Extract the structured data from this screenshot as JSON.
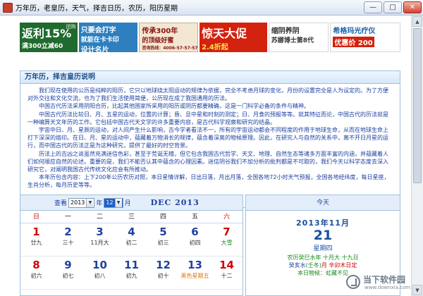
{
  "window": {
    "title": "万年历，老皇历，天气，择吉日历，农历，阳历星期",
    "min_glyph": "—",
    "max_glyph": "□",
    "close_glyph": "✕"
  },
  "ads": [
    {
      "line1": "",
      "big": "返利15%",
      "line2": "满300立减60",
      "tag": "团购"
    },
    {
      "line1": "只要会打字",
      "big": "",
      "line2": "就能在卡卡印",
      "line3": "设计名片"
    },
    {
      "line1": "传承300年",
      "big": "",
      "line2": "的顶级好蜜",
      "line3": "咨询热线：4006-57-57-57"
    },
    {
      "line1": "",
      "big": "惊天大促",
      "line2": "2.4折起"
    },
    {
      "line1": "缩阴养阴",
      "big": "",
      "line2": "苏娜博士第8代"
    },
    {
      "line1": "希格玛光疗仪",
      "big": "",
      "line2": "200",
      "tag": "优惠价"
    }
  ],
  "panel": {
    "title": "万年历，择吉皇历说明",
    "paragraphs": [
      "我们现在使用的公历是纯粹的阳历，它只以地球绕太阳运动的规律为依据，完全不考虑月球的变化，月份的设置完全是人为设定的。为了方便对外交往和文化交流，也为了我们生活使用简便，公历现在成了我国通用的历法。",
      "中国古代历法采用阴阳合历，比起其他国家所采用的阳历或阴历都要精确，这是一门科学必备的条件与精神。",
      "中国古代历法比较日、月、五星的运动，位置的计算；昏、旦中星和时刻的测定；日、月食的预报等等。就其特征而论，中国古代的历法就是一种编算天文年历的工作。它包括中国古代天文学的许多重要内容，是古代科学观察和研究的结晶。",
      "宇宙中日、月、星辰的运动，对人间产生什么影响，古今学者看法不一，所有的宇宙运动都会不同程度的作用于地球生命，从而在地球生命上打下深深的烙印。在日、月、星的运动中，蕴藏着万物消长的规律，蕴含着深奥的物候原理。因此，在研究人与自然的关系中，离不开日月星的运行，而中国古代的历法正是为这种研究，提供了最好的时空背景。",
      "历法上的吉凶之说虽然充满迷信色彩，甚至于荒诞无稽，但它包含我国古代哲学、天文、地理、自然生态等诸多方面丰富的内涵，并蕴藏着人们如何顺应自然的论述。重要的是，我们不能否认其中蕴含的心理因素。迷信阴谷我们不加分析的批判都是不可取的，我们今天以科学态度去深入研究它，对阐明我国古代传统文化应会有所推动。",
      "本年历包含内容：上下200年公历农历对照，本日星情详解，日出日落，月出月落，全国各地72小时天气预报，全国各地经纬度，每日星座，生肖分析，每月历史等等。"
    ]
  },
  "calendar": {
    "view_label": "查看",
    "year_value": "2013",
    "year_unit": "年",
    "month_value": "12",
    "month_unit": "月",
    "month_title": "DEC 2013",
    "weekdays": [
      "日",
      "一",
      "二",
      "三",
      "四",
      "五",
      "六"
    ],
    "weeks": [
      [
        {
          "n": "1",
          "l": "廿九",
          "nc": "red",
          "lc": ""
        },
        {
          "n": "2",
          "l": "三十",
          "nc": "",
          "lc": ""
        },
        {
          "n": "3",
          "l": "11月大",
          "nc": "",
          "lc": ""
        },
        {
          "n": "4",
          "l": "初二",
          "nc": "",
          "lc": ""
        },
        {
          "n": "5",
          "l": "初三",
          "nc": "",
          "lc": ""
        },
        {
          "n": "6",
          "l": "初四",
          "nc": "",
          "lc": ""
        },
        {
          "n": "7",
          "l": "大雪",
          "nc": "red",
          "lc": "green"
        }
      ],
      [
        {
          "n": "8",
          "l": "初六",
          "nc": "red",
          "lc": ""
        },
        {
          "n": "9",
          "l": "初七",
          "nc": "",
          "lc": ""
        },
        {
          "n": "10",
          "l": "初八",
          "nc": "",
          "lc": ""
        },
        {
          "n": "11",
          "l": "初九",
          "nc": "",
          "lc": ""
        },
        {
          "n": "12",
          "l": "初十",
          "nc": "",
          "lc": ""
        },
        {
          "n": "13",
          "l": "黑色星期五",
          "nc": "",
          "lc": "orange"
        },
        {
          "n": "14",
          "l": "十二",
          "nc": "red",
          "lc": ""
        }
      ]
    ]
  },
  "today": {
    "header": "今天",
    "year_month": "2013年11月",
    "day": "21",
    "weekday": "星期四",
    "lunar": "农历癸巳水年 十月大 十九日",
    "gz_a": "癸亥水",
    "gz_b": "(壬冬)",
    "gz_c": "月 辛卯木日定",
    "weather": "本日物候：虹藏不见"
  },
  "watermark": {
    "cn": "当下软件园",
    "en": "www.downxia.com"
  },
  "colors": {
    "accent": "#1a3fa0",
    "weekend_red": "#d10000",
    "solar_term_green": "#1a8a1a",
    "festival_orange": "#e0780a",
    "panel_border": "#9fc0de"
  }
}
